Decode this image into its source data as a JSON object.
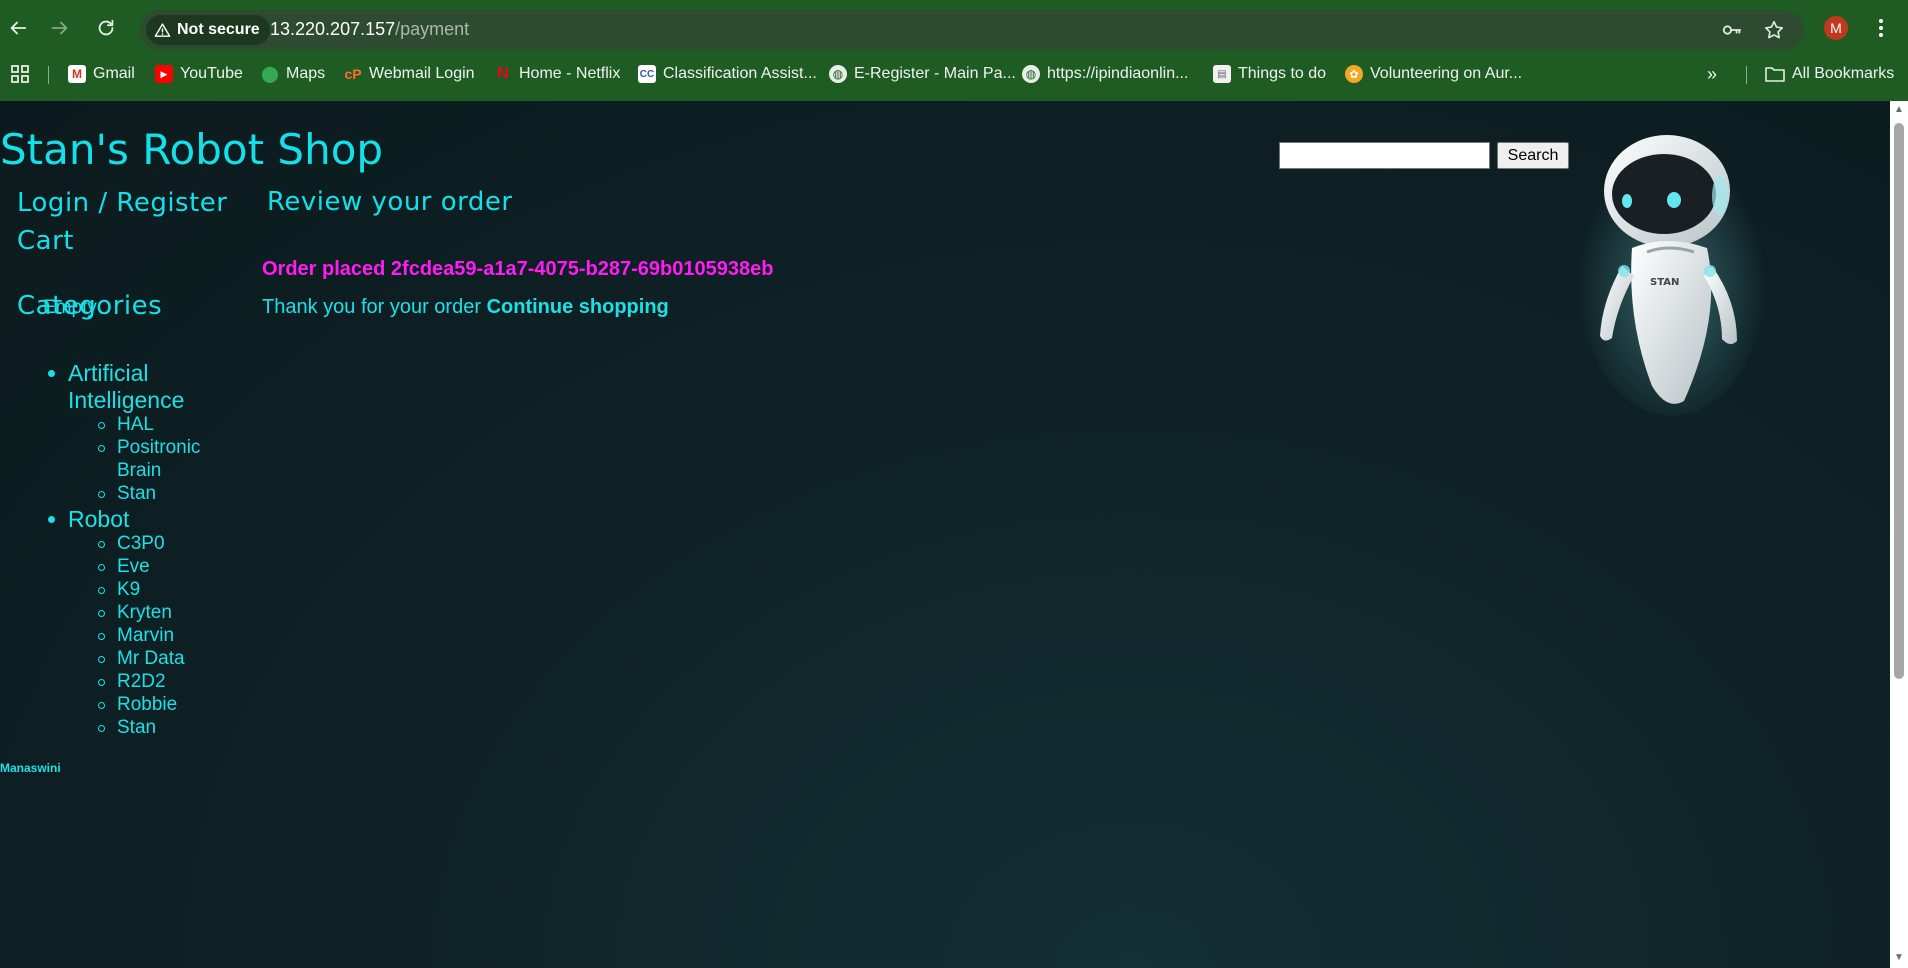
{
  "browser": {
    "security_label": "Not secure",
    "url_host": "13.220.207.157",
    "url_path": "/payment",
    "profile_initial": "M",
    "bookmarks": [
      {
        "label": "Gmail",
        "icon": "gmail-icon"
      },
      {
        "label": "YouTube",
        "icon": "youtube-icon"
      },
      {
        "label": "Maps",
        "icon": "maps-icon"
      },
      {
        "label": "Webmail Login",
        "icon": "cpanel-icon"
      },
      {
        "label": "Home - Netflix",
        "icon": "netflix-icon"
      },
      {
        "label": "Classification Assist...",
        "icon": "cc-icon"
      },
      {
        "label": "E-Register - Main Pa...",
        "icon": "globe-icon"
      },
      {
        "label": "https://ipindiaonlin...",
        "icon": "globe-icon"
      },
      {
        "label": "Things to do",
        "icon": "page-icon"
      },
      {
        "label": "Volunteering on Aur...",
        "icon": "volunteer-icon"
      }
    ],
    "all_bookmarks_label": "All Bookmarks"
  },
  "site": {
    "title": "Stan's Robot Shop",
    "search_button": "Search",
    "search_value": "",
    "robot_badge": "STAN"
  },
  "sidebar": {
    "login": "Login / Register",
    "cart_heading": "Cart",
    "cart_status": "Empty",
    "categories_heading": "Categories",
    "categories": [
      {
        "name_line1": "Artificial",
        "name_line2": "Intelligence",
        "items": [
          "HAL",
          "Positronic",
          "Brain",
          "Stan"
        ]
      },
      {
        "name_line1": "Robot",
        "items": [
          "C3P0",
          "Eve",
          "K9",
          "Kryten",
          "Marvin",
          "Mr Data",
          "R2D2",
          "Robbie",
          "Stan"
        ]
      }
    ]
  },
  "main": {
    "heading": "Review your order",
    "order_placed": "Order placed 2fcdea59-a1a7-4075-b287-69b0105938eb",
    "thanks_text": "Thank you for your order",
    "continue_link": "Continue shopping"
  },
  "footer": {
    "text": "Manaswini"
  },
  "colors": {
    "chrome_green": "#1f5c24",
    "accent_cyan": "#14e0ea",
    "order_magenta": "#ff1cf2",
    "page_bg": "#0d1b1e"
  }
}
